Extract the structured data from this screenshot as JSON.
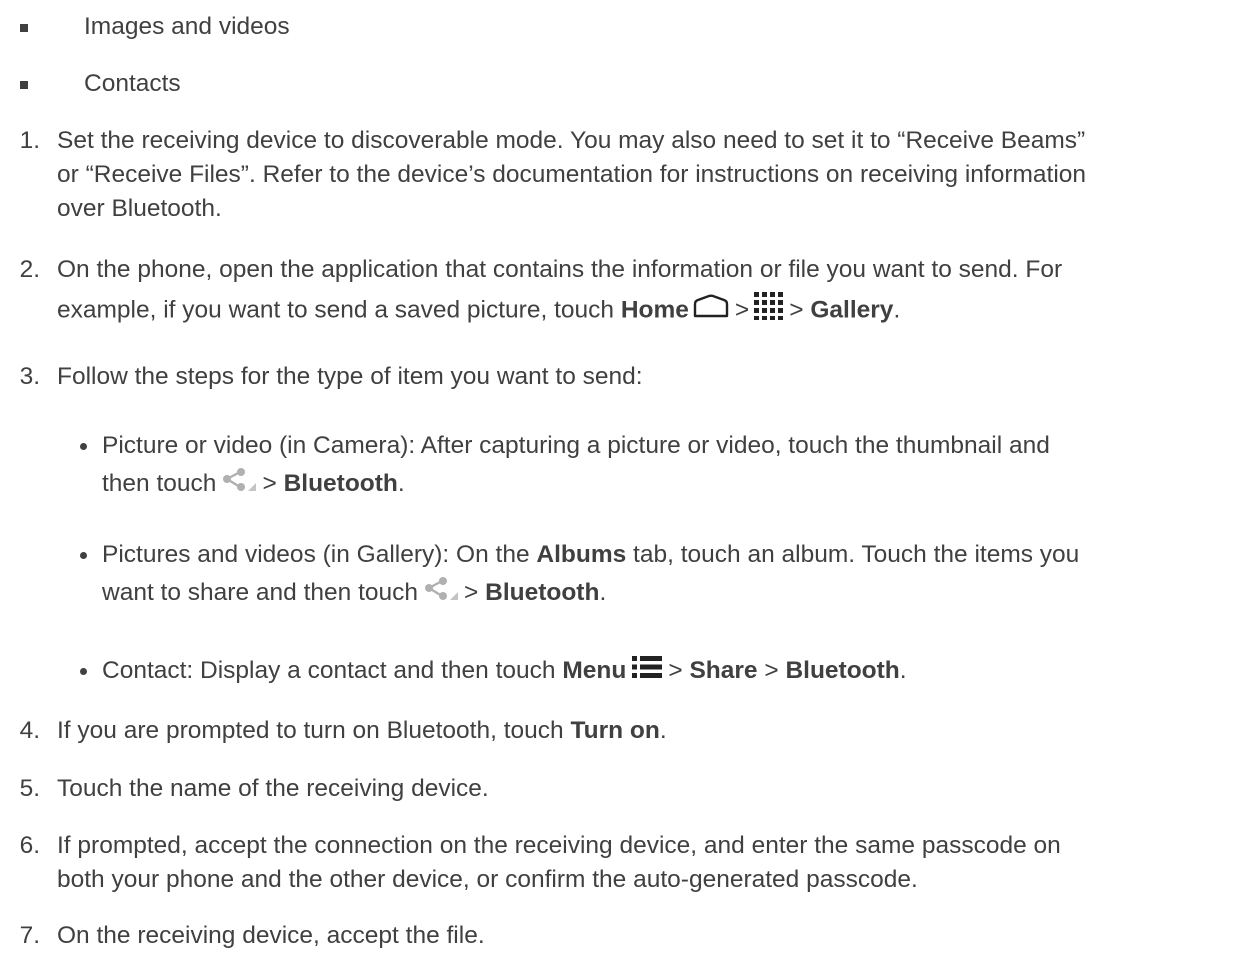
{
  "list_bullets": [
    "Images and videos",
    "Contacts"
  ],
  "steps": {
    "s1": {
      "num": "1.",
      "line1": "Set the receiving device to discoverable mode. You may also need to set it to “Receive Beams”",
      "line2": "or “Receive Files”. Refer to the device’s documentation for instructions on receiving information",
      "line3": "over Bluetooth."
    },
    "s2": {
      "num": "2.",
      "line1": "On the phone, open the application that contains the information or file you want to send. For",
      "line2_pre": "example, if you want to send a saved picture, touch ",
      "home": "Home",
      "sep": ">",
      "gallery": "Gallery",
      "end": "."
    },
    "s3": {
      "num": "3.",
      "text": "Follow the steps for the type of item you want to send:",
      "sub1": {
        "line1": "Picture or video (in Camera): After capturing a picture or video, touch the thumbnail and",
        "line2_pre": "then touch",
        "sep": ">",
        "bluetooth": "Bluetooth",
        "end": "."
      },
      "sub2": {
        "line1_pre": "Pictures and videos (in Gallery): On the ",
        "albums": "Albums",
        "line1_post": " tab, touch an album. Touch the items you",
        "line2_pre": "want to share and then touch",
        "sep": ">",
        "bluetooth": "Bluetooth",
        "end": "."
      },
      "sub3": {
        "pre": "Contact: Display a contact and then touch ",
        "menu": "Menu",
        "sep1": ">",
        "share": "Share",
        "sep2": ">",
        "bluetooth": "Bluetooth",
        "end": "."
      }
    },
    "s4": {
      "num": "4.",
      "pre": "If you are prompted to turn on Bluetooth, touch ",
      "turn_on": "Turn on",
      "end": "."
    },
    "s5": {
      "num": "5.",
      "text": "Touch the name of the receiving device."
    },
    "s6": {
      "num": "6.",
      "line1": "If prompted, accept the connection on the receiving device, and enter the same passcode on",
      "line2": "both your phone and the other device, or confirm the auto-generated passcode."
    },
    "s7": {
      "num": "7.",
      "text": "On the receiving device, accept the file."
    }
  },
  "icons": {
    "home": "home-icon",
    "apps": "apps-grid-icon",
    "share": "share-icon",
    "menu": "menu-icon"
  },
  "colors": {
    "text": "#404040",
    "icon": "#222222",
    "share_icon": "#b0b0b0"
  }
}
